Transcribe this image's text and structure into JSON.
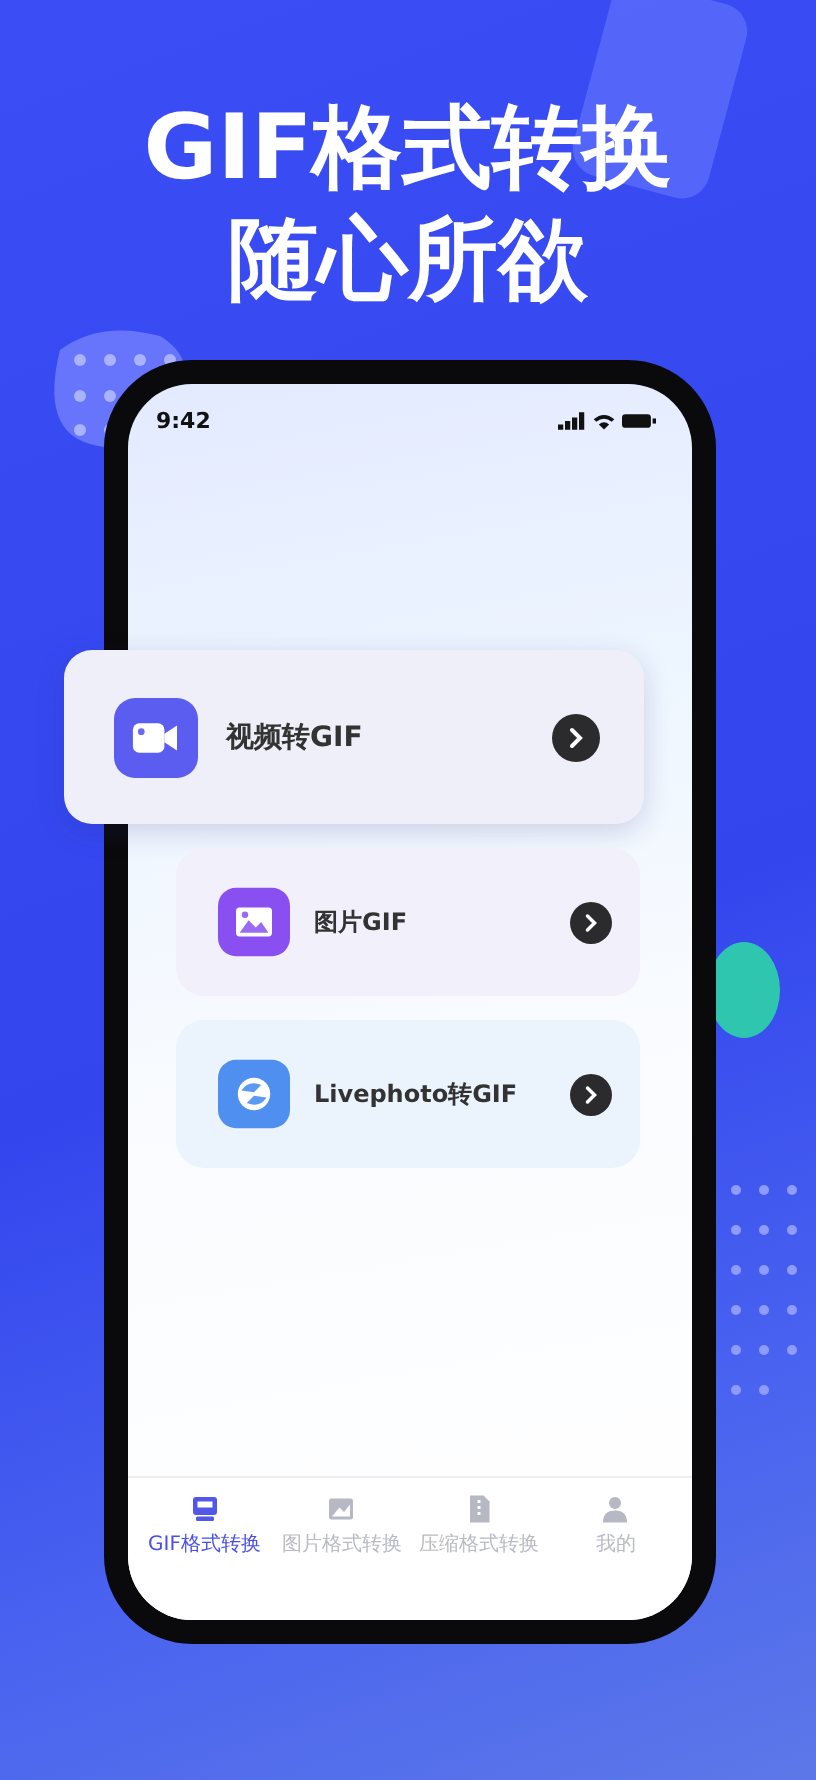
{
  "headline": [
    "GIF格式转换",
    "随心所欲"
  ],
  "status_bar": {
    "time": "9:42"
  },
  "features": [
    {
      "label": "视频转GIF",
      "kind": "video",
      "selected": true
    },
    {
      "label": "图片GIF",
      "kind": "image",
      "selected": false
    },
    {
      "label": "Livephoto转GIF",
      "kind": "live",
      "selected": false
    }
  ],
  "tabs": [
    {
      "label": "GIF格式转换",
      "kind": "gif",
      "selected": true
    },
    {
      "label": "图片格式转换",
      "kind": "image",
      "selected": false
    },
    {
      "label": "压缩格式转换",
      "kind": "zip",
      "selected": false
    },
    {
      "label": "我的",
      "kind": "profile",
      "selected": false
    }
  ]
}
